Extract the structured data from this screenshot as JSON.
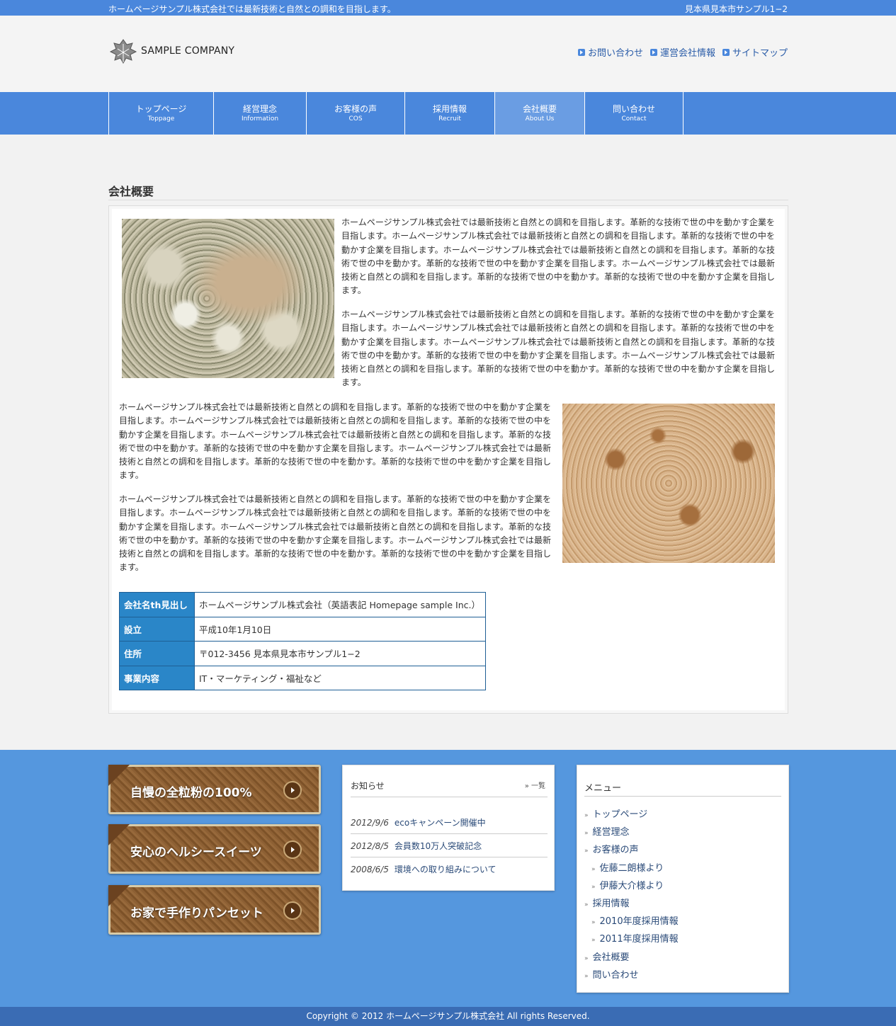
{
  "topbar": {
    "tagline": "ホームページサンプル株式会社では最新技術と自然との調和を目指します。",
    "address": "見本県見本市サンプル1−2"
  },
  "header": {
    "logo_text": "SAMPLE COMPANY",
    "links": [
      "お問い合わせ",
      "運営会社情報",
      "サイトマップ"
    ]
  },
  "nav": [
    {
      "jp": "トップページ",
      "en": "Toppage"
    },
    {
      "jp": "経営理念",
      "en": "Information"
    },
    {
      "jp": "お客様の声",
      "en": "COS"
    },
    {
      "jp": "採用情報",
      "en": "Recruit"
    },
    {
      "jp": "会社概要",
      "en": "About Us",
      "active": true
    },
    {
      "jp": "問い合わせ",
      "en": "Contact"
    }
  ],
  "main": {
    "title": "会社概要",
    "paragraphs": [
      "ホームページサンプル株式会社では最新技術と自然との調和を目指します。革新的な技術で世の中を動かす企業を目指します。ホームページサンプル株式会社では最新技術と自然との調和を目指します。革新的な技術で世の中を動かす企業を目指します。ホームページサンプル株式会社では最新技術と自然との調和を目指します。革新的な技術で世の中を動かす。革新的な技術で世の中を動かす企業を目指します。ホームページサンプル株式会社では最新技術と自然との調和を目指します。革新的な技術で世の中を動かす。革新的な技術で世の中を動かす企業を目指します。",
      "ホームページサンプル株式会社では最新技術と自然との調和を目指します。革新的な技術で世の中を動かす企業を目指します。ホームページサンプル株式会社では最新技術と自然との調和を目指します。革新的な技術で世の中を動かす企業を目指します。ホームページサンプル株式会社では最新技術と自然との調和を目指します。革新的な技術で世の中を動かす。革新的な技術で世の中を動かす企業を目指します。ホームページサンプル株式会社では最新技術と自然との調和を目指します。革新的な技術で世の中を動かす。革新的な技術で世の中を動かす企業を目指します。",
      "ホームページサンプル株式会社では最新技術と自然との調和を目指します。革新的な技術で世の中を動かす企業を目指します。ホームページサンプル株式会社では最新技術と自然との調和を目指します。革新的な技術で世の中を動かす企業を目指します。ホームページサンプル株式会社では最新技術と自然との調和を目指します。革新的な技術で世の中を動かす。革新的な技術で世の中を動かす企業を目指します。ホームページサンプル株式会社では最新技術と自然との調和を目指します。革新的な技術で世の中を動かす。革新的な技術で世の中を動かす企業を目指します。",
      "ホームページサンプル株式会社では最新技術と自然との調和を目指します。革新的な技術で世の中を動かす企業を目指します。ホームページサンプル株式会社では最新技術と自然との調和を目指します。革新的な技術で世の中を動かす企業を目指します。ホームページサンプル株式会社では最新技術と自然との調和を目指します。革新的な技術で世の中を動かす。革新的な技術で世の中を動かす企業を目指します。ホームページサンプル株式会社では最新技術と自然との調和を目指します。革新的な技術で世の中を動かす。革新的な技術で世の中を動かす企業を目指します。"
    ],
    "table": [
      {
        "th": "会社名th見出し",
        "td": "ホームページサンプル株式会社（英語表記 Homepage sample Inc.）"
      },
      {
        "th": "設立",
        "td": "平成10年1月10日"
      },
      {
        "th": "住所",
        "td": "〒012-3456 見本県見本市サンプル1−2"
      },
      {
        "th": "事業内容",
        "td": "IT・マーケティング・福祉など"
      }
    ]
  },
  "banners": [
    "自慢の全粒粉の100%",
    "安心のヘルシースイーツ",
    "お家で手作りパンセット"
  ],
  "news": {
    "heading": "お知らせ",
    "all_label": "一覧",
    "items": [
      {
        "date": "2012/9/6",
        "text": "ecoキャンペーン開催中"
      },
      {
        "date": "2012/8/5",
        "text": "会員数10万人突破記念"
      },
      {
        "date": "2008/6/5",
        "text": "環境への取り組みについて"
      }
    ]
  },
  "menu": {
    "heading": "メニュー",
    "items": [
      {
        "label": "トップページ",
        "level": 0
      },
      {
        "label": "経営理念",
        "level": 0
      },
      {
        "label": "お客様の声",
        "level": 0
      },
      {
        "label": "佐藤二朗様より",
        "level": 1
      },
      {
        "label": "伊藤大介様より",
        "level": 1
      },
      {
        "label": "採用情報",
        "level": 0
      },
      {
        "label": "2010年度採用情報",
        "level": 1
      },
      {
        "label": "2011年度採用情報",
        "level": 1
      },
      {
        "label": "会社概要",
        "level": 0
      },
      {
        "label": "問い合わせ",
        "level": 0
      }
    ]
  },
  "footer": {
    "copyright": "Copyright © 2012 ホームページサンプル株式会社 All rights Reserved."
  },
  "colors": {
    "accent": "#4a87dc",
    "footer_bg": "#5597de",
    "table_header": "#2a86c8",
    "copyright_bg": "#3a6cb4"
  }
}
